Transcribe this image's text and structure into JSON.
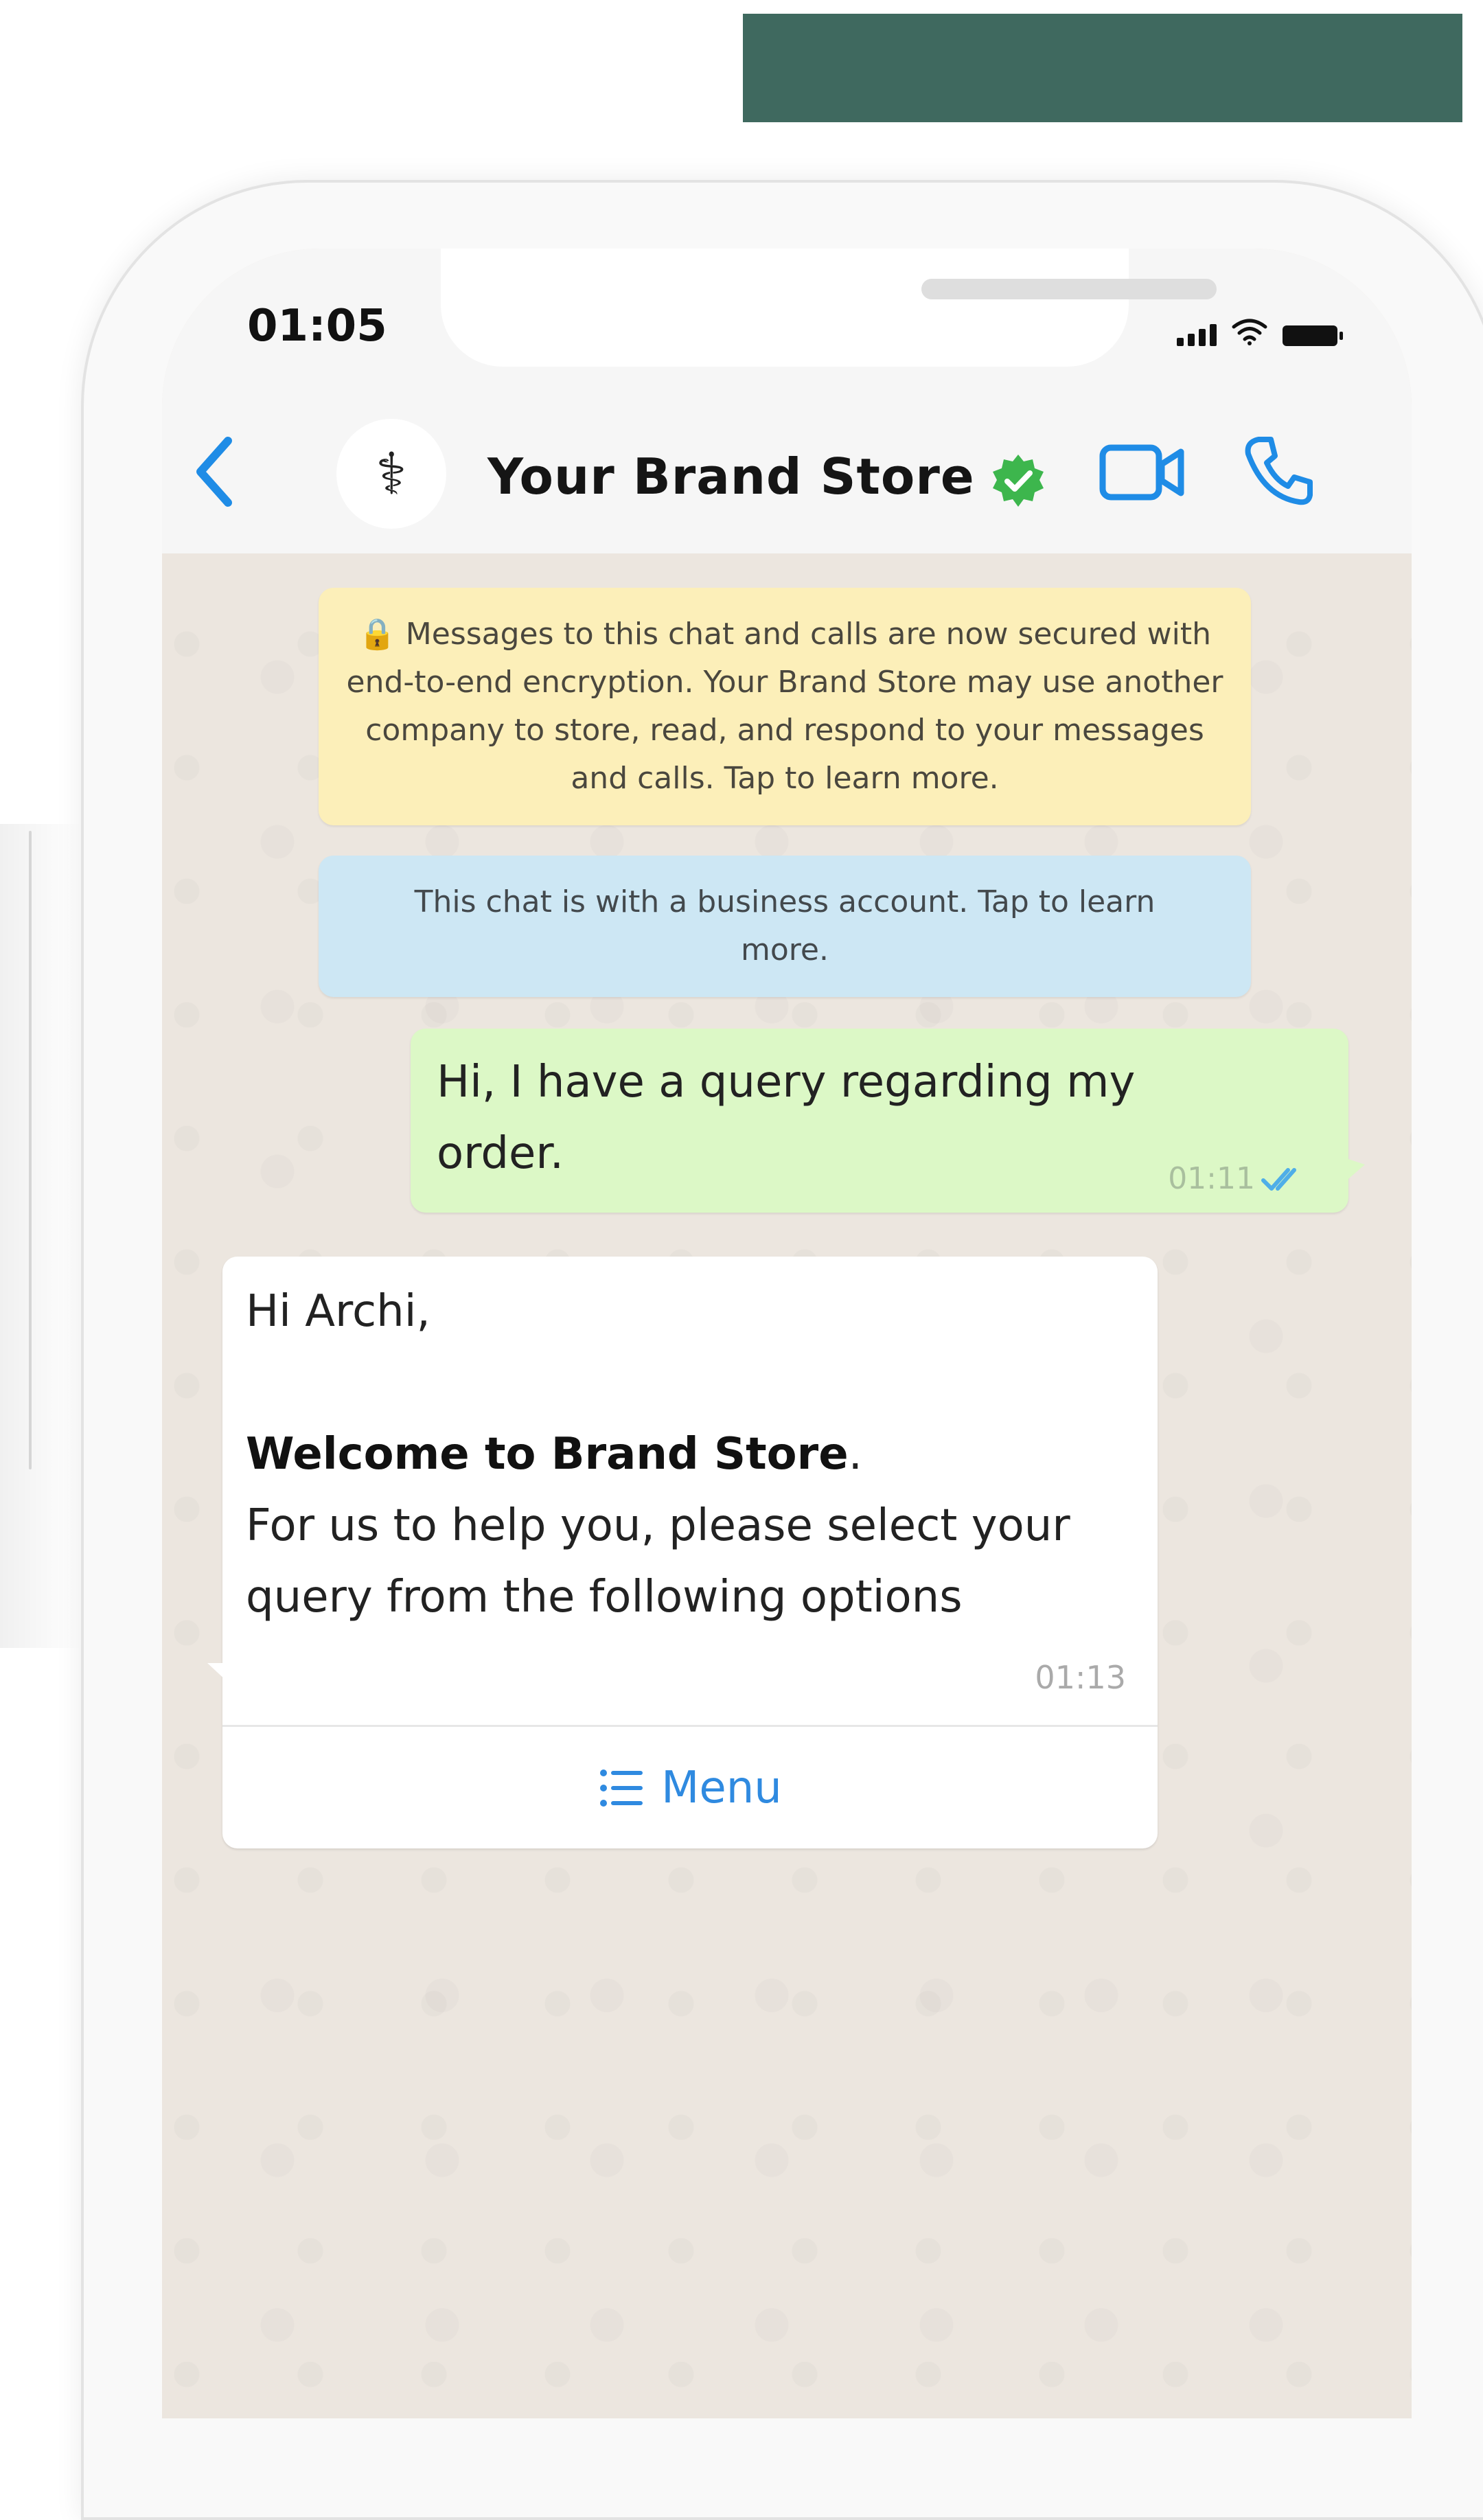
{
  "status_bar": {
    "time": "01:05"
  },
  "header": {
    "contact_name": "Your Brand Store",
    "back_icon": "chevron-left-icon",
    "avatar_icon": "brand-logo-icon",
    "verified_icon": "verified-badge-icon",
    "video_icon": "video-call-icon",
    "call_icon": "phone-icon",
    "accent_color": "#1f8ce6"
  },
  "system_messages": {
    "encryption": "🔒 Messages to this chat and calls are now secured with end-to-end encryption. Your Brand Store may use another company to store, read, and respond to your messages and calls. Tap to learn more.",
    "business": "This chat is with a business account. Tap to learn more."
  },
  "outgoing": {
    "text": "Hi, I have a query regarding my order.",
    "time": "01:11",
    "status_icon": "double-check-icon"
  },
  "incoming": {
    "greeting": "Hi Archi,",
    "bold_line": "Welcome to Brand Store",
    "bold_suffix": ".",
    "body": "For us to help you, please select your query from the following options",
    "time": "01:13",
    "menu_label": "Menu",
    "menu_icon": "list-icon"
  }
}
